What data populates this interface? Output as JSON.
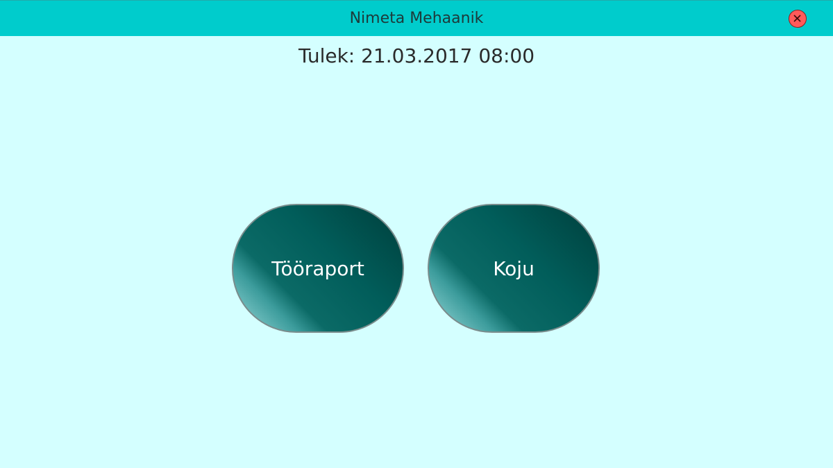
{
  "window": {
    "title": "Nimeta Mehaanik"
  },
  "status": {
    "arrival": "Tulek: 21.03.2017 08:00"
  },
  "actions": {
    "report_label": "Tööraport",
    "home_label": "Koju"
  },
  "colors": {
    "titlebar": "#00cccc",
    "background": "#d4ffff",
    "button_dark": "#015d5a",
    "close": "#ff5a5a"
  },
  "icons": {
    "close": "close-circle-icon"
  }
}
